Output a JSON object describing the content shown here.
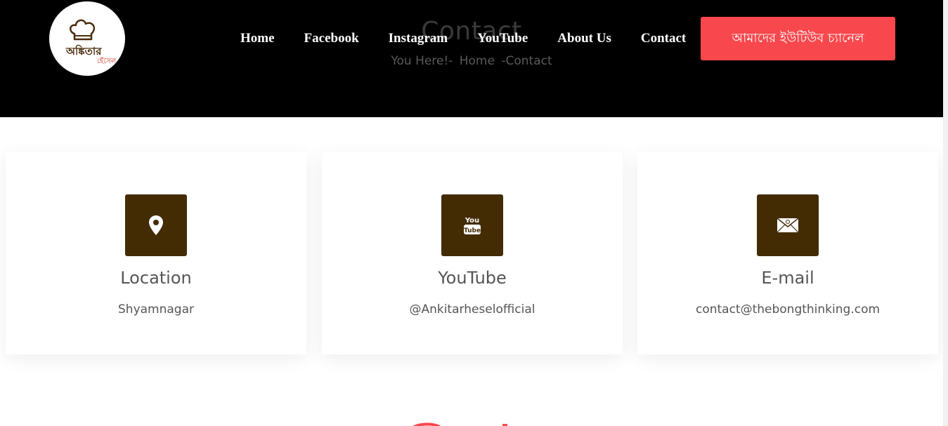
{
  "hero": {
    "title": "Contact",
    "breadcrumb": [
      "You Here!-",
      "Home",
      "-Contact"
    ]
  },
  "logo": {
    "main_text": "অঙ্কিতার",
    "sub_text": "হেঁসেল"
  },
  "nav": {
    "items": [
      {
        "label": "Home"
      },
      {
        "label": "Facebook"
      },
      {
        "label": "Instagram"
      },
      {
        "label": "YouTube"
      },
      {
        "label": "About Us"
      },
      {
        "label": "Contact"
      }
    ],
    "cta_label": "আমাদের ইউটিউব চ্যানেল"
  },
  "cards": [
    {
      "icon": "location-pin-icon",
      "title": "Location",
      "text": "Shyamnagar"
    },
    {
      "icon": "youtube-icon",
      "title": "YouTube",
      "text": "@Ankitarheselofficial",
      "icon_text_top": "You",
      "icon_text_bottom": "Tube"
    },
    {
      "icon": "email-icon",
      "title": "E-mail",
      "text": "contact@thebongthinking.com"
    }
  ],
  "colors": {
    "header_bg": "#000000",
    "cta_bg": "#f8484d",
    "icon_bg": "#432c04",
    "text": "#555555"
  }
}
